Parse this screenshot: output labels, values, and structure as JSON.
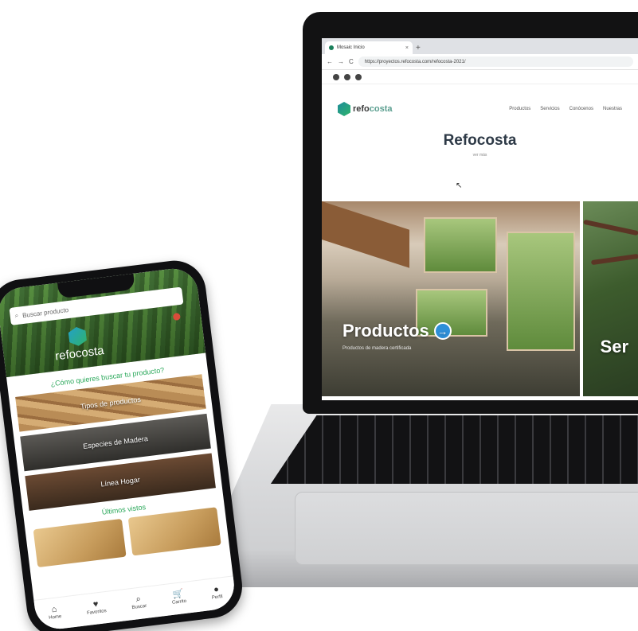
{
  "laptop": {
    "browser": {
      "tab_title": "Mosaic Inicio",
      "close_glyph": "×",
      "new_tab_glyph": "+",
      "back_glyph": "←",
      "forward_glyph": "→",
      "reload_glyph": "C",
      "url": "https://proyectos.refocosta.com/refocosta-2021/"
    },
    "site": {
      "logo_prefix": "refo",
      "logo_suffix": "costa",
      "nav": [
        "Productos",
        "Servicios",
        "Conócenos",
        "Nuestras"
      ],
      "title": "Refocosta",
      "subtitle": "ver más",
      "hero_left_title": "Productos",
      "hero_left_arrow": "→",
      "hero_left_subtitle": "Productos de madera certificada",
      "hero_right_title": "Ser",
      "cursor_glyph": "↖"
    }
  },
  "phone": {
    "search_placeholder": "Buscar producto",
    "search_icon": "⌕",
    "logo_text": "refocosta",
    "question": "¿Cómo quieres buscar tu producto?",
    "categories": [
      "Tipos de productos",
      "Especies de Madera",
      "Línea Hogar"
    ],
    "recent_title": "Últimos vistos",
    "nav": [
      {
        "label": "Home",
        "icon": "⌂"
      },
      {
        "label": "Favoritos",
        "icon": "♥"
      },
      {
        "label": "Buscar",
        "icon": "⌕"
      },
      {
        "label": "Carrito",
        "icon": "🛒"
      },
      {
        "label": "Perfil",
        "icon": "●"
      }
    ]
  }
}
